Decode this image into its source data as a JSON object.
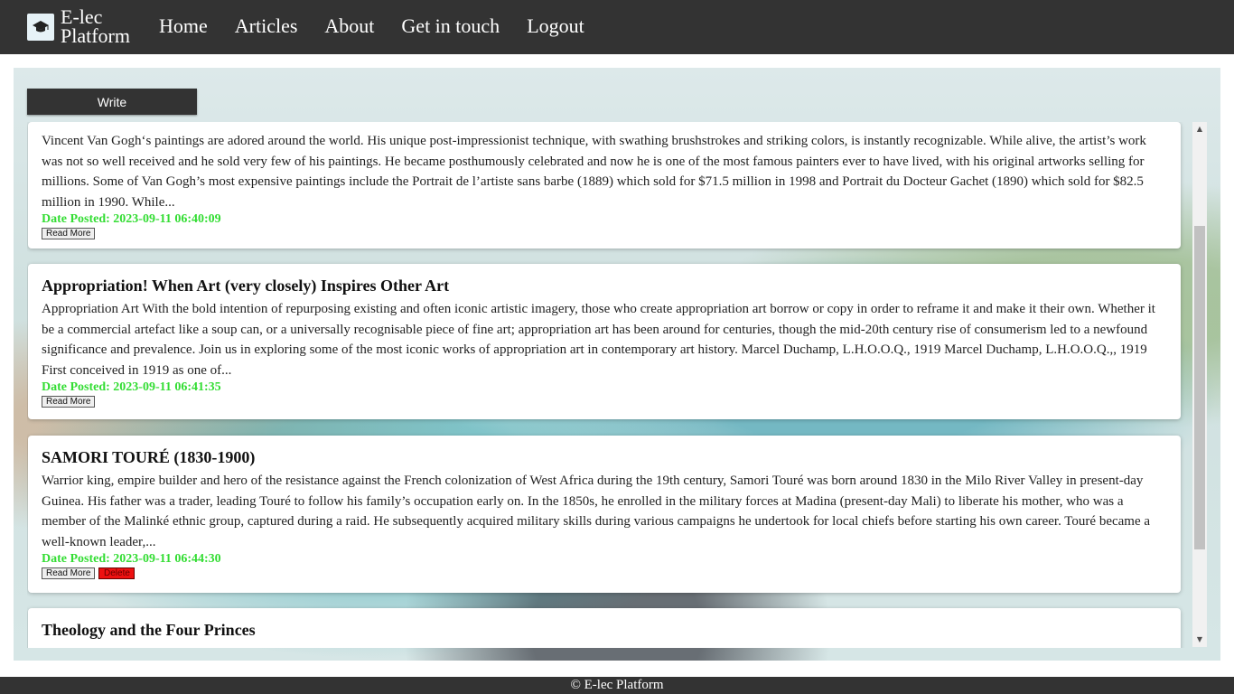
{
  "nav": {
    "brand_line1": "E-lec",
    "brand_line2": "Platform",
    "links": [
      "Home",
      "Articles",
      "About",
      "Get in touch",
      "Logout"
    ]
  },
  "main": {
    "write_label": "Write"
  },
  "posts": [
    {
      "title": "",
      "excerpt": "Vincent Van Gogh‘s paintings are adored around the world. His unique post-impressionist technique, with swathing brushstrokes and striking colors, is instantly recognizable. While alive, the artist’s work was not so well received and he sold very few of his paintings. He became posthumously celebrated and now he is one of the most famous painters ever to have lived, with his original artworks selling for millions. Some of Van Gogh’s most expensive paintings include the Portrait de l’artiste sans barbe (1889) which sold for $71.5 million in 1998 and Portrait du Docteur Gachet (1890) which sold for $82.5 million in 1990. While...",
      "date": "Date Posted: 2023-09-11 06:40:09",
      "read_more": "Read More"
    },
    {
      "title": "Appropriation! When Art (very closely) Inspires Other Art",
      "excerpt": "Appropriation Art With the bold intention of repurposing existing and often iconic artistic imagery, those who create appropriation art borrow or copy in order to reframe it and make it their own. Whether it be a commercial artefact like a soup can, or a universally recognisable piece of fine art; appropriation art has been around for centuries, though the mid-20th century rise of consumerism led to a newfound significance and prevalence. Join us in exploring some of the most iconic works of appropriation art in contemporary art history. Marcel Duchamp, L.H.O.O.Q., 1919 Marcel Duchamp, L.H.O.O.Q.,, 1919 First conceived in 1919 as one of...",
      "date": "Date Posted: 2023-09-11 06:41:35",
      "read_more": "Read More"
    },
    {
      "title": "SAMORI TOURÉ (1830-1900)",
      "excerpt": "Warrior king, empire builder and hero of the resistance against the French colonization of West Africa during the 19th century, Samori Touré was born around 1830 in the Milo River Valley in present-day Guinea. His father was a trader, leading Touré to follow his family’s occupation early on. In the 1850s, he enrolled in the military forces at Madina (present-day Mali) to liberate his mother, who was a member of the Malinké ethnic group, captured during a raid. He subsequently acquired military skills during various campaigns he undertook for local chiefs before starting his own career. Touré became a well-known leader,...",
      "date": "Date Posted: 2023-09-11 06:44:30",
      "read_more": "Read More",
      "delete": "Delete"
    },
    {
      "title": "Theology and the Four Princes"
    }
  ],
  "footer": {
    "text": "© E-lec Platform"
  },
  "colors": {
    "nav_bg": "#333333",
    "date_green": "#33dd33",
    "delete_red": "#ee1111"
  }
}
